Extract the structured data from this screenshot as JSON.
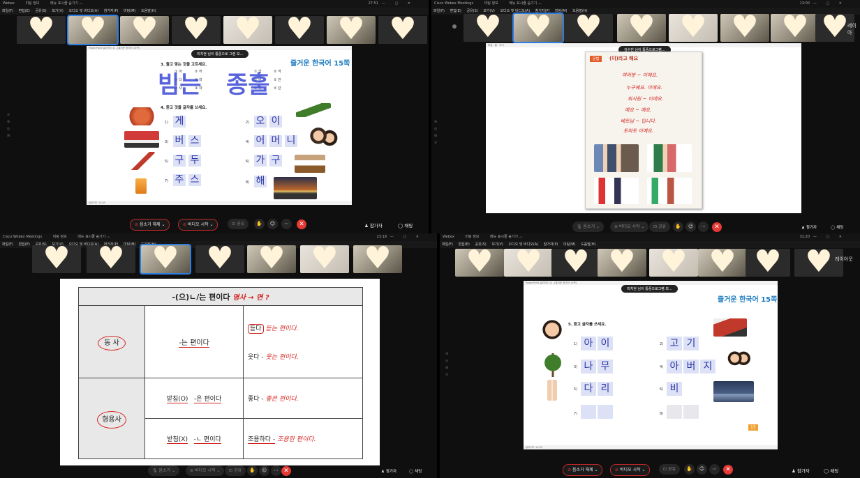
{
  "panels": {
    "p1": {
      "titlebar": {
        "app": "Webex",
        "info": "미팅 정보",
        "hide": "메뉴 표시줄 숨기기 ︿",
        "clock": "27:51"
      },
      "menu": [
        "파일(F)",
        "편집(E)",
        "공유(S)",
        "보기(V)",
        "오디오 및 비디오(A)",
        "참가자(P)",
        "미팅(M)",
        "도움말(H)"
      ],
      "banner": "미치현 님이 통증으로 그렌 보...",
      "slide_title": "즐거운 한국어 15쪽",
      "q3": "3. 들고 맞는 것을 고르세요.",
      "q4": "4. 듣고 것을 글자를 쓰세요.",
      "options_left": [
        "① 아",
        "② 어",
        "① 다",
        "② 라",
        "③ 사",
        "④ 자"
      ],
      "options_right": [
        "① 갑",
        "② 악",
        "① 만",
        "② 안",
        "① 이",
        "② 단"
      ],
      "hw_top": [
        "빔는",
        "종훌"
      ],
      "items": [
        {
          "n": "1)",
          "boxes": [
            "게"
          ]
        },
        {
          "n": "2)",
          "boxes": [
            "오",
            "이"
          ]
        },
        {
          "n": "3)",
          "boxes": [
            "버",
            "스"
          ]
        },
        {
          "n": "4)",
          "boxes": [
            "어",
            "머",
            "니"
          ]
        },
        {
          "n": "5)",
          "boxes": [
            "구",
            "두"
          ]
        },
        {
          "n": "6)",
          "boxes": [
            "가",
            "구"
          ]
        },
        {
          "n": "7)",
          "boxes": [
            "주",
            "스"
          ]
        },
        {
          "n": "8)",
          "boxes": [
            "해"
          ]
        }
      ],
      "controls": {
        "mute": "음소거 해제",
        "video": "비디오 시작",
        "share": "공유",
        "participants": "참가자",
        "chat": "채팅"
      }
    },
    "p2": {
      "titlebar": {
        "app": "Cisco Webex Meetings",
        "info": "미팅 정보",
        "hide": "메뉴 표시줄 숨기기 ︿",
        "clock": "13:00"
      },
      "menu": [
        "파일(F)",
        "편집(E)",
        "공유(S)",
        "보기(V)",
        "오디오 및 비디오(A)",
        "참가자(P)",
        "미팅(M)",
        "도움말(H)"
      ],
      "strip_label": "레이아",
      "banner": "김수진 님이 통증으로그램...",
      "book_heading": "(이)라고 해요",
      "book_tag": "문법",
      "book_lines": [
        "여러분 ~ 이에요.",
        "누구예요. 이에요.",
        "회사원 ~ 이에요.",
        "예요 ~ 예요.",
        "베트남 ~ 입니다.",
        "토마토 이예요."
      ],
      "controls": {
        "mute": "음소거",
        "video": "비디오 시작",
        "share": "공유",
        "participants": "참가자",
        "chat": "채팅"
      }
    },
    "p3": {
      "titlebar": {
        "app": "Cisco Webex Meetings",
        "info": "미팅 정보",
        "hide": "메뉴 표시줄 숨기기 ︿",
        "clock": "23:19"
      },
      "menu": [
        "파일(F)",
        "편집(E)",
        "공유(S)",
        "보기(V)",
        "오디오 및 비디오(A)",
        "참가자(P)",
        "미팅(M)",
        "도움말(H)"
      ],
      "table": {
        "title": "-(으)ㄴ/는 편이다",
        "verb": "동 사",
        "verb_rule": "-는 편이다",
        "adj": "형용사",
        "batchim_yes": "받침(O)",
        "batchim_yes_rule": "-은 편이다",
        "batchim_no": "받침(X)",
        "batchim_no_rule": "-ㄴ 편이다",
        "ex1": "듣다",
        "ex1_hw": "듣는 편이다.",
        "ex2": "웃다 -",
        "ex2_hw": "웃는 편이다.",
        "ex3": "좋다 -",
        "ex3_hw": "좋은 편이다.",
        "ex4": "조용하다 -",
        "ex4_hw": "조용한 편이다.",
        "title_hw": "명사 → 면 ?"
      },
      "controls": {
        "mute": "음소거",
        "video": "비디오 시작",
        "share": "공유",
        "participants": "참가자",
        "chat": "채팅"
      }
    },
    "p4": {
      "titlebar": {
        "app": "Webex",
        "info": "미팅 정보",
        "hide": "메뉴 표시줄 숨기기 ︿",
        "clock": "31:20"
      },
      "menu": [
        "파일(F)",
        "편집(E)",
        "공유(S)",
        "보기(V)",
        "오디오 및 비디오(A)",
        "참가자(P)",
        "미팅(M)",
        "도움말(H)"
      ],
      "strip_label": "레이아웃",
      "banner": "미치현 님이 통증으로그램 보...",
      "slide_title": "즐거운 한국어 15쪽",
      "q5": "5. 듣고 글자를 쓰세요.",
      "items": [
        {
          "n": "1)",
          "boxes": [
            "아",
            "이"
          ]
        },
        {
          "n": "2)",
          "boxes": [
            "고",
            "기"
          ]
        },
        {
          "n": "3)",
          "boxes": [
            "나",
            "무"
          ]
        },
        {
          "n": "4)",
          "boxes": [
            "아",
            "버",
            "지"
          ]
        },
        {
          "n": "5)",
          "boxes": [
            "다",
            "리"
          ]
        },
        {
          "n": "6)",
          "boxes": [
            "비"
          ]
        },
        {
          "n": "7)",
          "boxes": [
            "",
            ""
          ]
        },
        {
          "n": "8)",
          "boxes": [
            "",
            ""
          ]
        }
      ],
      "page_number": "15",
      "controls": {
        "mute": "음소거 해제",
        "video": "비디오 시작",
        "share": "공유",
        "participants": "참가자",
        "chat": "채팅"
      }
    }
  },
  "colors": {
    "end": "#e53935",
    "accent": "#2e7de1",
    "hand_blue": "#3b49d6",
    "hand_red": "#d4231f"
  }
}
